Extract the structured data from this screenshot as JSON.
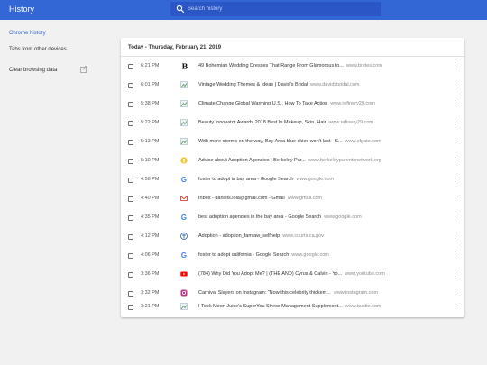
{
  "app": {
    "title": "History"
  },
  "search": {
    "placeholder": "Search history"
  },
  "sidebar": {
    "items": [
      {
        "label": "Chrome history",
        "active": true
      },
      {
        "label": "Tabs from other devices",
        "active": false
      },
      {
        "label": "Clear browsing data",
        "active": false
      }
    ]
  },
  "colors": {
    "header": "#3367d6",
    "search_bg": "#2a56c6",
    "page_bg": "#f1f1f1"
  },
  "main": {
    "heading": "Today - Thursday, February 21, 2019",
    "entries": [
      {
        "time": "6:21 PM",
        "title": "49 Bohemian Wedding Dresses That Range From Glamorous to...",
        "domain": "www.brides.com",
        "icon": "brides-logo-icon"
      },
      {
        "time": "6:01 PM",
        "title": "Vintage Wedding Themes & Ideas | David's Bridal",
        "domain": "www.davidsbridal.com",
        "icon": "broken-image-icon"
      },
      {
        "time": "5:38 PM",
        "title": "Climate Change Global Warming U.S., How To Take Action",
        "domain": "www.refinery29.com",
        "icon": "broken-image-icon"
      },
      {
        "time": "5:22 PM",
        "title": "Beauty Innovator Awards 2018 Best In Makeup, Skin, Hair",
        "domain": "www.refinery29.com",
        "icon": "broken-image-icon"
      },
      {
        "time": "5:13 PM",
        "title": "With more storms on the way, Bay Area blue skies won't last - S...",
        "domain": "www.sfgate.com",
        "icon": "broken-image-icon"
      },
      {
        "time": "5:10 PM",
        "title": "Advice about Adoption Agencies | Berkeley Par...",
        "domain": "www.berkeleyparentsnetwork.org",
        "icon": "parents-network-icon"
      },
      {
        "time": "4:56 PM",
        "title": "foster to adopt in bay area - Google Search",
        "domain": "www.google.com",
        "icon": "google-icon"
      },
      {
        "time": "4:40 PM",
        "title": "Inbox - daniels.lola@gmail.com - Gmail",
        "domain": "www.gmail.com",
        "icon": "gmail-icon"
      },
      {
        "time": "4:35 PM",
        "title": "best adoption agencies in the bay area - Google Search",
        "domain": "www.google.com",
        "icon": "google-icon"
      },
      {
        "time": "4:12 PM",
        "title": "Adoption - adoption_famlaw_selfhelp",
        "domain": "www.courts.ca.gov",
        "icon": "courts-seal-icon"
      },
      {
        "time": "4:06 PM",
        "title": "foster to adopt california - Google Search",
        "domain": "www.google.com",
        "icon": "google-icon"
      },
      {
        "time": "3:36 PM",
        "title": "(784) Why Did You Adopt Me? | (THE AND) Cyrus & Calvin - Yo...",
        "domain": "www.youtube.com",
        "icon": "youtube-icon"
      },
      {
        "time": "3:32 PM",
        "title": "Carnival Slayers on Instagram: \"Now this celebrity thickem...",
        "domain": "www.instagram.com",
        "icon": "instagram-icon"
      },
      {
        "time": "3:21 PM",
        "title": "I Took Moon Juice's SuperYou Stress Management Supplement...",
        "domain": "www.bustle.com",
        "icon": "broken-image-icon"
      }
    ]
  }
}
